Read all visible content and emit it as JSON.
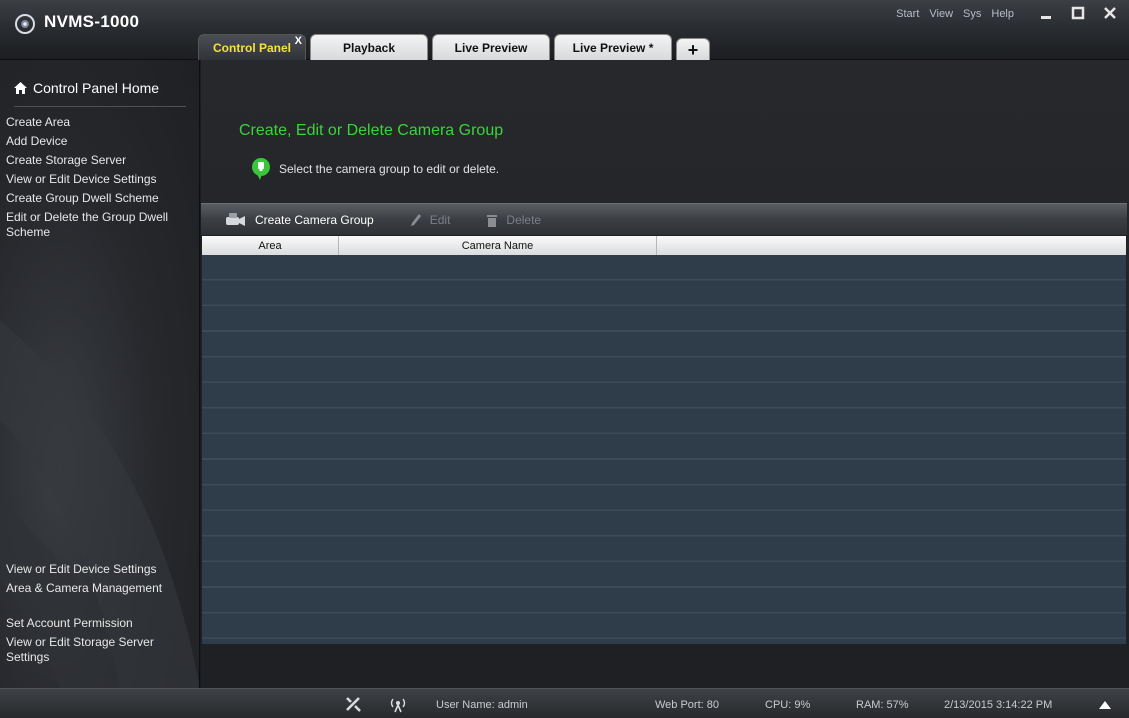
{
  "app": {
    "title": "NVMS-1000",
    "menu": [
      "Start",
      "View",
      "Sys",
      "Help"
    ]
  },
  "tabs": [
    {
      "label": "Control Panel",
      "active": true,
      "close_label": "X"
    },
    {
      "label": "Playback",
      "active": false
    },
    {
      "label": "Live Preview",
      "active": false
    },
    {
      "label": "Live Preview *",
      "active": false
    }
  ],
  "tab_add_label": "+",
  "sidebar": {
    "home_label": "Control Panel Home",
    "top_items": [
      "Create Area",
      "Add Device",
      "Create Storage Server",
      "View or Edit Device Settings",
      "Create Group Dwell Scheme",
      "Edit or Delete the Group Dwell Scheme"
    ],
    "bottom_items": [
      "View or Edit Device Settings",
      "Area & Camera Management",
      "Set Account Permission",
      "View or Edit Storage Server Settings"
    ]
  },
  "main": {
    "title": "Create, Edit or Delete Camera Group",
    "hint": "Select the camera group to edit or delete.",
    "toolbar": {
      "create": "Create Camera Group",
      "edit": "Edit",
      "delete": "Delete"
    },
    "table": {
      "columns": [
        "Area",
        "Camera Name",
        ""
      ],
      "rows": []
    }
  },
  "status": {
    "username": "User Name: admin",
    "web_port": "Web Port: 80",
    "cpu": "CPU: 9%",
    "ram": "RAM: 57%",
    "datetime": "2/13/2015 3:14:22 PM"
  },
  "colors": {
    "accent_green": "#3ad43a",
    "active_tab_text": "#f5e23a"
  }
}
